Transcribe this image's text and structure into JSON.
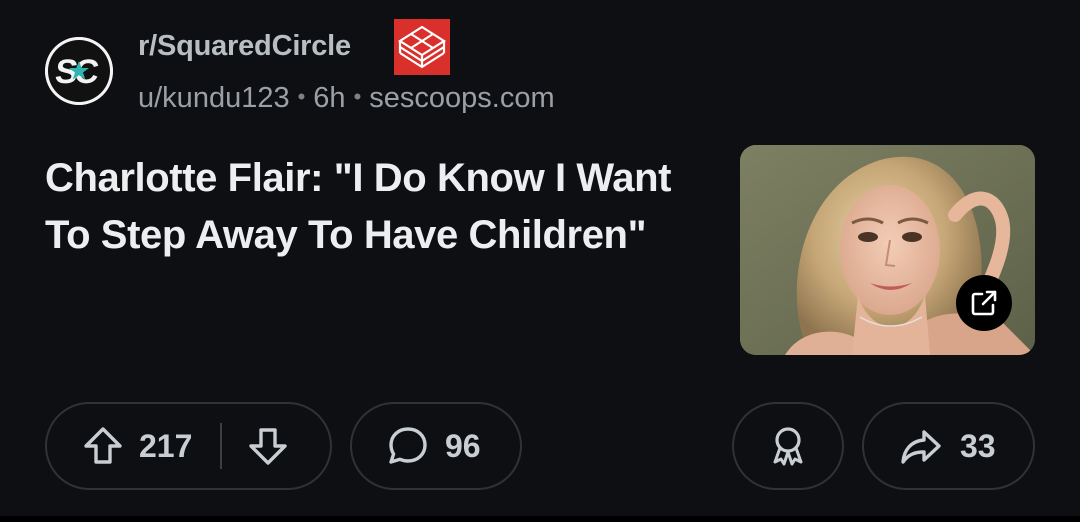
{
  "post": {
    "subreddit": "r/SquaredCircle",
    "author": "u/kundu123",
    "age": "6h",
    "domain": "sescoops.com",
    "title": "Charlotte Flair: \"I Do Know I Want To Step Away To Have Children\""
  },
  "actions": {
    "upvotes": "217",
    "comments": "96",
    "shares": "33"
  },
  "icons": {
    "avatar": "sc-logo-icon",
    "flair": "wrestling-ring-icon",
    "external": "external-link-icon",
    "upvote": "arrow-up-icon",
    "downvote": "arrow-down-icon",
    "comment": "speech-bubble-icon",
    "award": "award-ribbon-icon",
    "share": "share-arrow-icon"
  },
  "colors": {
    "background": "#0d0f12",
    "flair_red": "#d9302c",
    "text": "#eceef0",
    "muted": "#9aa0a6"
  }
}
